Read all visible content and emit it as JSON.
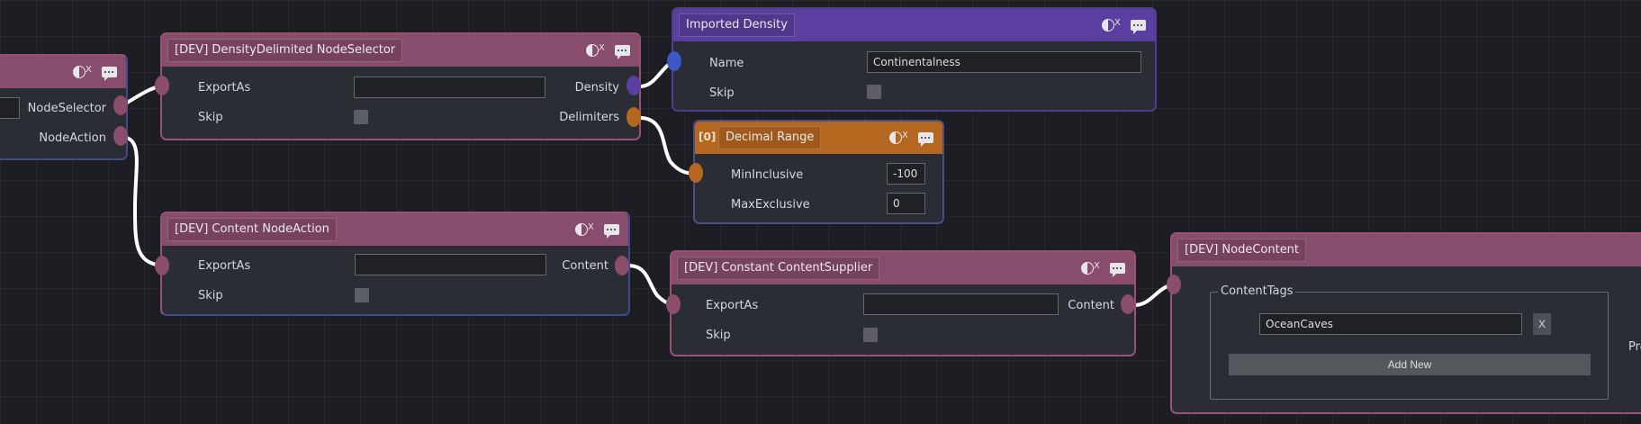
{
  "nodes": {
    "partial_left": {
      "outputs": [
        "NodeSelector",
        "NodeAction"
      ]
    },
    "density_selector": {
      "title": "[DEV] DensityDelimited NodeSelector",
      "fields": {
        "export_as_label": "ExportAs",
        "export_as_value": "",
        "skip_label": "Skip"
      },
      "outputs": [
        "Density",
        "Delimiters"
      ]
    },
    "imported_density": {
      "title": "Imported Density",
      "fields": {
        "name_label": "Name",
        "name_value": "Continentalness",
        "skip_label": "Skip"
      }
    },
    "decimal_range": {
      "prefix": "[0]",
      "title": "Decimal Range",
      "fields": {
        "min_label": "MinInclusive",
        "min_value": "-100",
        "max_label": "MaxExclusive",
        "max_value": "0"
      }
    },
    "content_action": {
      "title": "[DEV] Content NodeAction",
      "fields": {
        "export_as_label": "ExportAs",
        "export_as_value": "",
        "skip_label": "Skip"
      },
      "outputs": [
        "Content"
      ]
    },
    "constant_supplier": {
      "title": "[DEV] Constant ContentSupplier",
      "fields": {
        "export_as_label": "ExportAs",
        "export_as_value": "",
        "skip_label": "Skip"
      },
      "outputs": [
        "Content"
      ]
    },
    "node_content": {
      "title": "[DEV] NodeContent",
      "group_label": "ContentTags",
      "tag_value": "OceanCaves",
      "remove_label": "X",
      "add_label": "Add New",
      "truncated_label": "Pro"
    }
  },
  "colors": {
    "pink": "#884c6c",
    "purple": "#5a3fa0",
    "orange": "#b5661f",
    "blue_port": "#3c58c8",
    "wire": "#ffffff"
  }
}
